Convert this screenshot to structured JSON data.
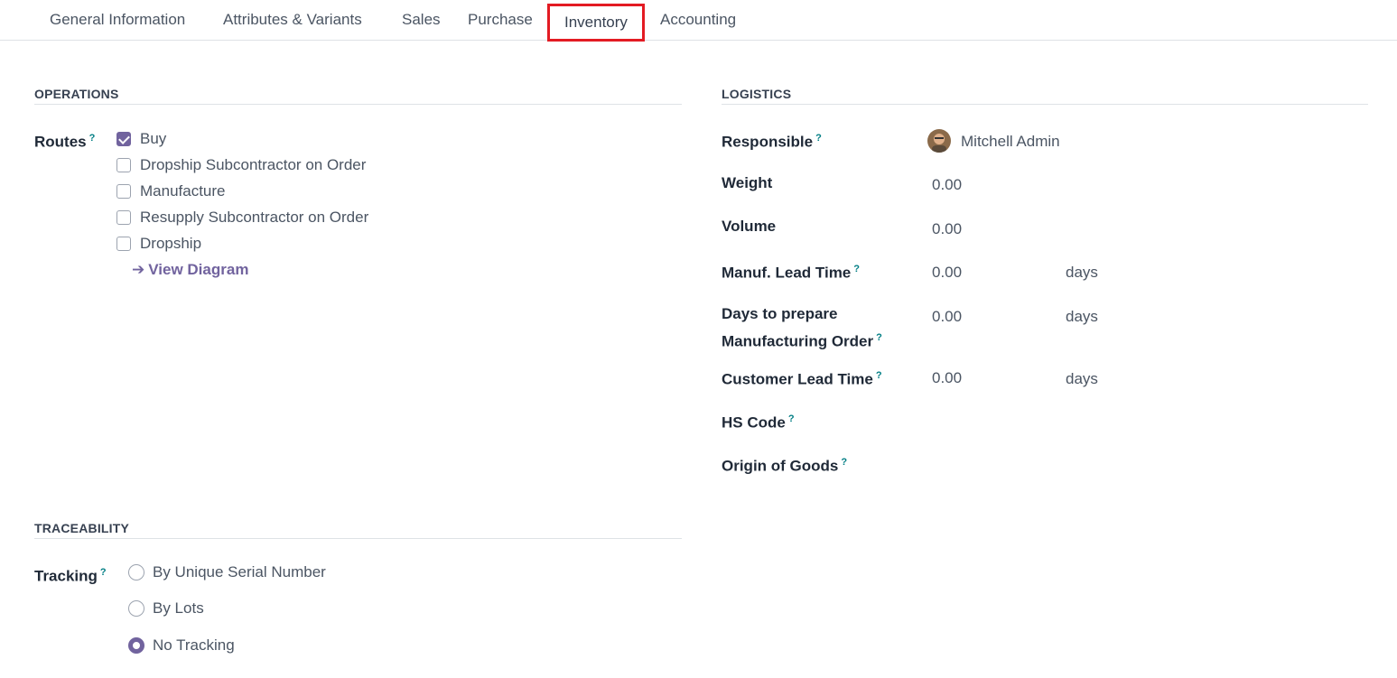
{
  "tabs": [
    {
      "label": "General Information"
    },
    {
      "label": "Attributes & Variants"
    },
    {
      "label": "Sales"
    },
    {
      "label": "Purchase"
    },
    {
      "label": "Inventory"
    },
    {
      "label": "Accounting"
    }
  ],
  "active_tab": "Inventory",
  "operations": {
    "title": "OPERATIONS",
    "routes_label": "Routes",
    "help": "?",
    "routes": [
      {
        "label": "Buy",
        "checked": true
      },
      {
        "label": "Dropship Subcontractor on Order",
        "checked": false
      },
      {
        "label": "Manufacture",
        "checked": false
      },
      {
        "label": "Resupply Subcontractor on Order",
        "checked": false
      },
      {
        "label": "Dropship",
        "checked": false
      }
    ],
    "view_diagram": "View Diagram"
  },
  "logistics": {
    "title": "LOGISTICS",
    "responsible_label": "Responsible",
    "responsible_value": "Mitchell Admin",
    "weight_label": "Weight",
    "weight_value": "0.00",
    "volume_label": "Volume",
    "volume_value": "0.00",
    "manuf_lead_label": "Manuf. Lead Time",
    "manuf_lead_value": "0.00",
    "days_prepare_label_1": "Days to prepare",
    "days_prepare_label_2": "Manufacturing Order",
    "days_prepare_value": "0.00",
    "customer_lead_label": "Customer Lead Time",
    "customer_lead_value": "0.00",
    "unit_days": "days",
    "hs_code_label": "HS Code",
    "origin_label": "Origin of Goods"
  },
  "traceability": {
    "title": "TRACEABILITY",
    "tracking_label": "Tracking",
    "options": [
      {
        "label": "By Unique Serial Number",
        "checked": false
      },
      {
        "label": "By Lots",
        "checked": false
      },
      {
        "label": "No Tracking",
        "checked": true
      }
    ]
  },
  "colors": {
    "accent": "#71639e",
    "highlight": "#e31b23",
    "help": "#017e84"
  }
}
